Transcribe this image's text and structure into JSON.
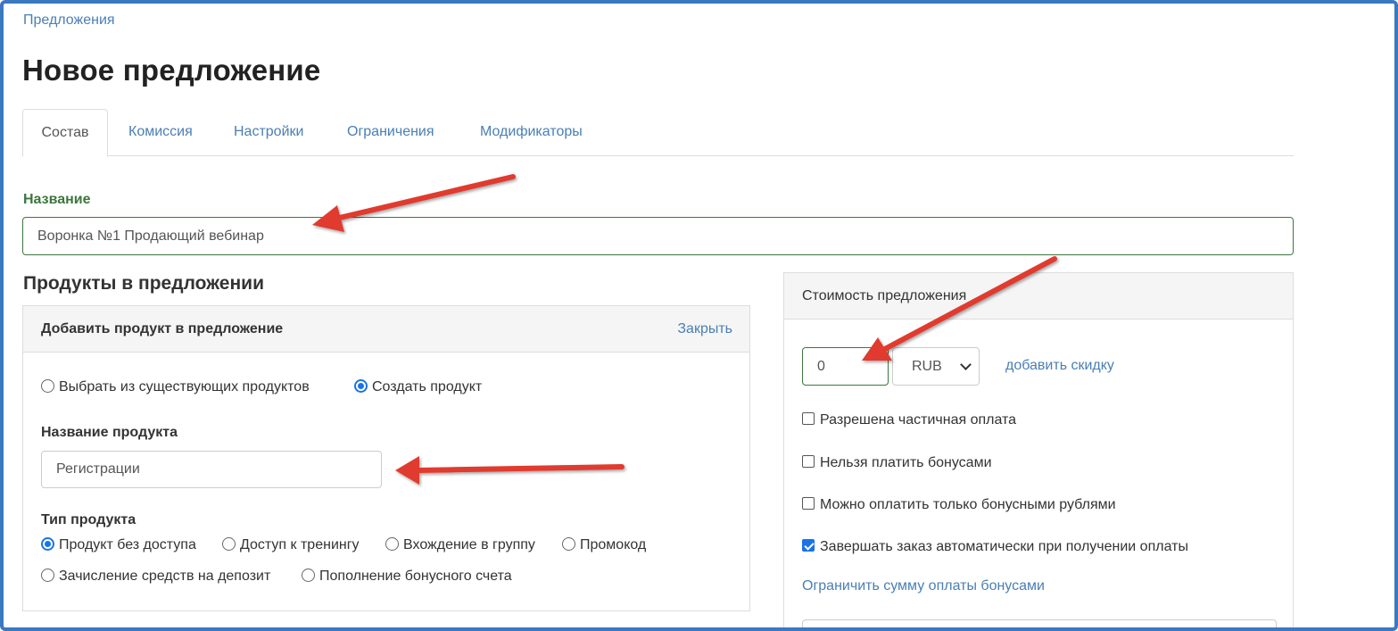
{
  "breadcrumb": "Предложения",
  "page_title": "Новое предложение",
  "tabs": [
    {
      "label": "Состав"
    },
    {
      "label": "Комиссия"
    },
    {
      "label": "Настройки"
    },
    {
      "label": "Ограничения"
    },
    {
      "label": "Модификаторы"
    }
  ],
  "name_field": {
    "label": "Название",
    "value": "Воронка №1 Продающий вебинар"
  },
  "products_section_title": "Продукты в предложении",
  "add_product_panel": {
    "title": "Добавить продукт в предложение",
    "close_label": "Закрыть",
    "source_options": [
      {
        "label": "Выбрать из существующих продуктов",
        "selected": false
      },
      {
        "label": "Создать продукт",
        "selected": true
      }
    ],
    "product_name_label": "Название продукта",
    "product_name_value": "Регистрации",
    "product_type_label": "Тип продукта",
    "product_types": [
      {
        "label": "Продукт без доступа",
        "selected": true
      },
      {
        "label": "Доступ к тренингу",
        "selected": false
      },
      {
        "label": "Вхождение в группу",
        "selected": false
      },
      {
        "label": "Промокод",
        "selected": false
      },
      {
        "label": "Зачисление средств на депозит",
        "selected": false
      },
      {
        "label": "Пополнение бонусного счета",
        "selected": false
      }
    ]
  },
  "price_panel": {
    "title": "Стоимость предложения",
    "price_value": "0",
    "currency": "RUB",
    "add_discount_label": "добавить скидку",
    "checkboxes": [
      {
        "label": "Разрешена частичная оплата",
        "checked": false
      },
      {
        "label": "Нельзя платить бонусами",
        "checked": false
      },
      {
        "label": "Можно оплатить только бонусными рублями",
        "checked": false
      },
      {
        "label": "Завершать заказ автоматически при получении оплаты",
        "checked": true
      }
    ],
    "limit_bonus_label": "Ограничить сумму оплаты бонусами"
  },
  "colors": {
    "accent_link": "#4a7fb5",
    "success_border": "#3c763d",
    "annotation_arrow": "#e03a2f",
    "frame": "#3a78c0"
  }
}
